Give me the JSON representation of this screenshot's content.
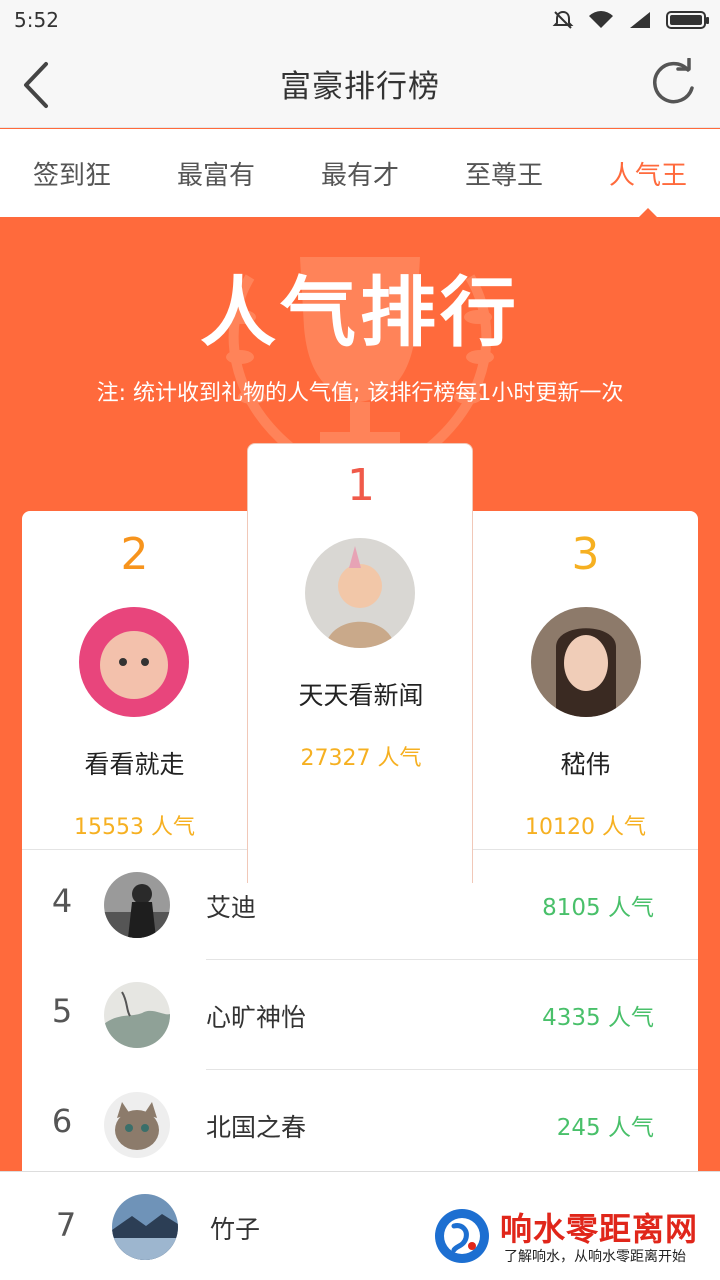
{
  "statusbar": {
    "time": "5:52",
    "icons": [
      "mute-icon",
      "wifi-icon",
      "signal-icon",
      "battery-icon"
    ]
  },
  "header": {
    "title": "富豪排行榜",
    "back_icon": "chevron-left-icon",
    "refresh_icon": "refresh-icon"
  },
  "tabs": [
    {
      "label": "签到狂",
      "active": false
    },
    {
      "label": "最富有",
      "active": false
    },
    {
      "label": "最有才",
      "active": false
    },
    {
      "label": "至尊王",
      "active": false
    },
    {
      "label": "人气王",
      "active": true
    }
  ],
  "banner": {
    "title": "人气排行",
    "note": "注: 统计收到礼物的人气值; 该排行榜每1小时更新一次"
  },
  "top3": [
    {
      "rank": "1",
      "name": "天天看新闻",
      "score": "27327 人气",
      "color": "#f05a4a"
    },
    {
      "rank": "2",
      "name": "看看就走",
      "score": "15553 人气",
      "color": "#f7941d"
    },
    {
      "rank": "3",
      "name": "嵇伟",
      "score": "10120 人气",
      "color": "#f6b021"
    }
  ],
  "list": [
    {
      "rank": "4",
      "name": "艾迪",
      "score": "8105 人气"
    },
    {
      "rank": "5",
      "name": "心旷神怡",
      "score": "4335 人气"
    },
    {
      "rank": "6",
      "name": "北国之春",
      "score": "245 人气"
    },
    {
      "rank": "7",
      "name": "竹子"
    }
  ],
  "watermark": {
    "title": "响水零距离网",
    "subtitle": "了解响水，从响水零距离开始"
  },
  "colors": {
    "accent": "#ff6a3c",
    "score_gold": "#f6b021",
    "score_green": "#49c06a"
  }
}
